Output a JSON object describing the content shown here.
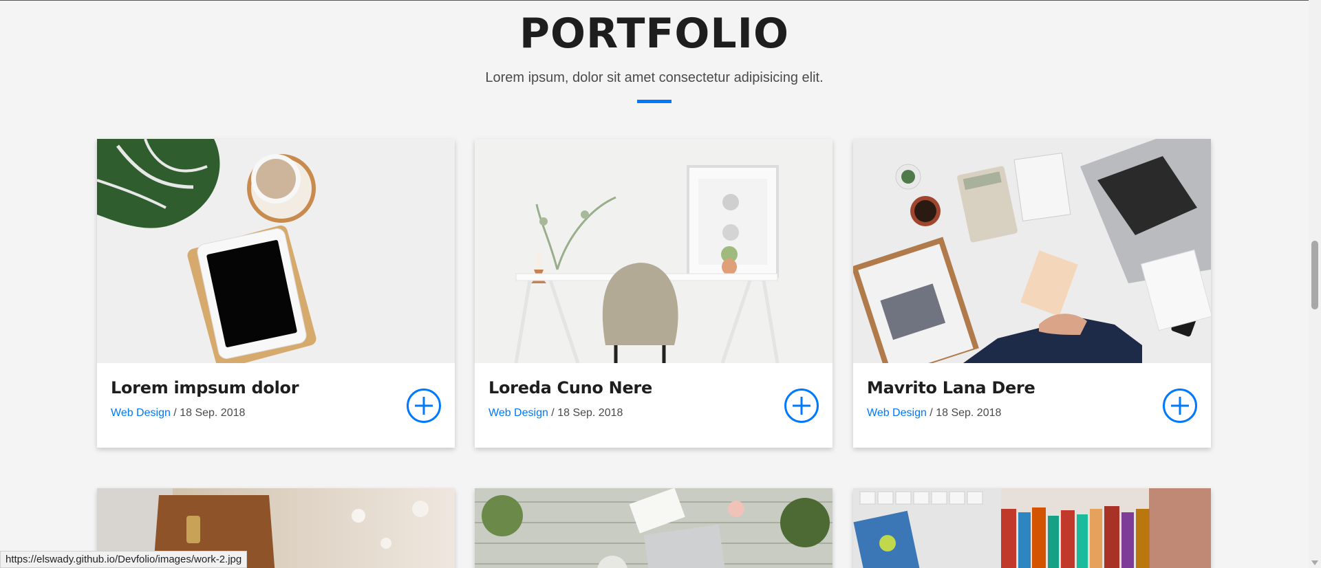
{
  "section": {
    "title": "PORTFOLIO",
    "subtitle": "Lorem ipsum, dolor sit amet consectetur adipisicing elit."
  },
  "cards": [
    {
      "title": "Lorem impsum dolor",
      "category": "Web Design",
      "separator": " / ",
      "date": "18 Sep. 2018",
      "image": "plant-tablet-coffee"
    },
    {
      "title": "Loreda Cuno Nere",
      "category": "Web Design",
      "separator": " / ",
      "date": "18 Sep. 2018",
      "image": "white-desk-chair"
    },
    {
      "title": "Mavrito Lana Dere",
      "category": "Web Design",
      "separator": " / ",
      "date": "18 Sep. 2018",
      "image": "business-desk-laptop"
    }
  ],
  "row2_images": [
    "leather-bag-laptop",
    "flowers-desk-laptop",
    "keyboard-books"
  ],
  "status_bar": {
    "url": "https://elswady.github.io/Devfolio/images/work-2.jpg"
  },
  "colors": {
    "accent": "#0078ff",
    "background": "#f4f4f4",
    "card": "#ffffff",
    "text": "#1e1e1e"
  }
}
